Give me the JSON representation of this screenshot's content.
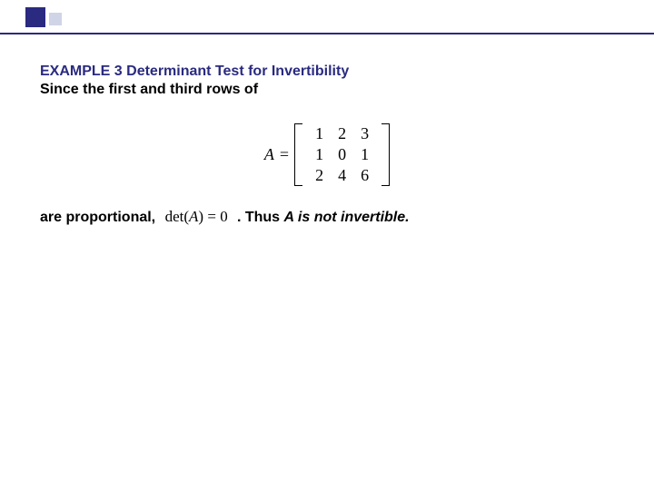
{
  "header": {
    "title": "EXAMPLE 3 Determinant Test for Invertibility",
    "line2": "Since the first and third rows of"
  },
  "matrix": {
    "lhs_var": "A",
    "equals": "=",
    "rows": [
      {
        "c0": "1",
        "c1": "2",
        "c2": "3"
      },
      {
        "c0": "1",
        "c1": "0",
        "c2": "1"
      },
      {
        "c0": "2",
        "c1": "4",
        "c2": "6"
      }
    ]
  },
  "concl": {
    "pre": "are proportional, ",
    "det_word": "det",
    "det_open": "(",
    "det_var": "A",
    "det_close": ")",
    "eq": " = ",
    "zero": "0",
    "thus": " . Thus ",
    "tail": "A is not invertible."
  }
}
